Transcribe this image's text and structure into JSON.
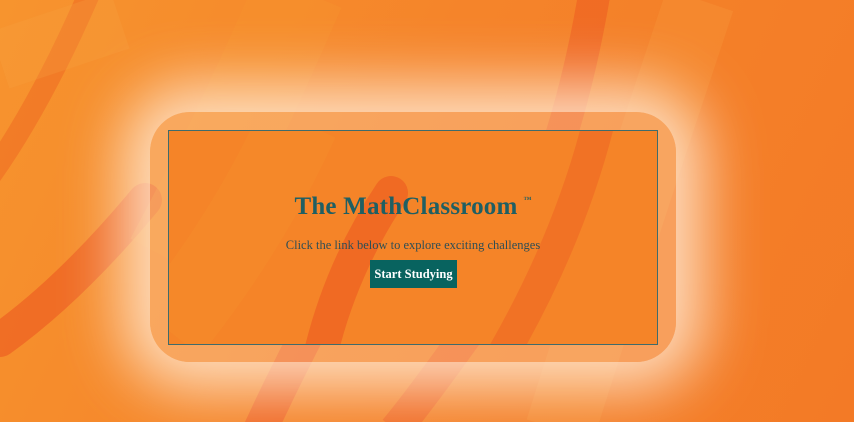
{
  "colors": {
    "background": "#f5842a",
    "panel": "#f58428",
    "panel_border": "#3f6b6b",
    "title": "#1f5f63",
    "button": "#08635f",
    "button_text": "#ffffff"
  },
  "hero": {
    "title": "The MathClassroom",
    "trademark": "™",
    "subtitle": "Click the link below to explore exciting challenges",
    "cta_label": "Start Studying"
  }
}
